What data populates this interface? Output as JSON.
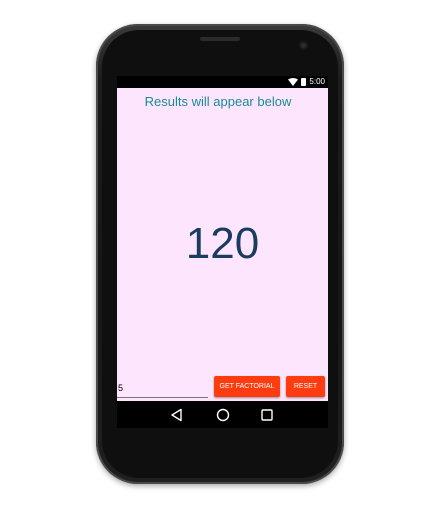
{
  "status_bar": {
    "time": "5:00",
    "wifi_icon": "wifi-icon",
    "battery_icon": "battery-icon"
  },
  "app": {
    "results_label": "Results will appear below",
    "result_value": "120",
    "input_value": "5",
    "factorial_button": "GET FACTORIAL",
    "reset_button": "RESET"
  },
  "nav_bar": {
    "back_icon": "back-triangle-icon",
    "home_icon": "home-circle-icon",
    "recents_icon": "recents-square-icon"
  },
  "colors": {
    "screen_background": "#fde6fd",
    "label_color": "#1a8a9a",
    "result_color": "#1a3c5e",
    "button_color": "#ff3b10"
  }
}
